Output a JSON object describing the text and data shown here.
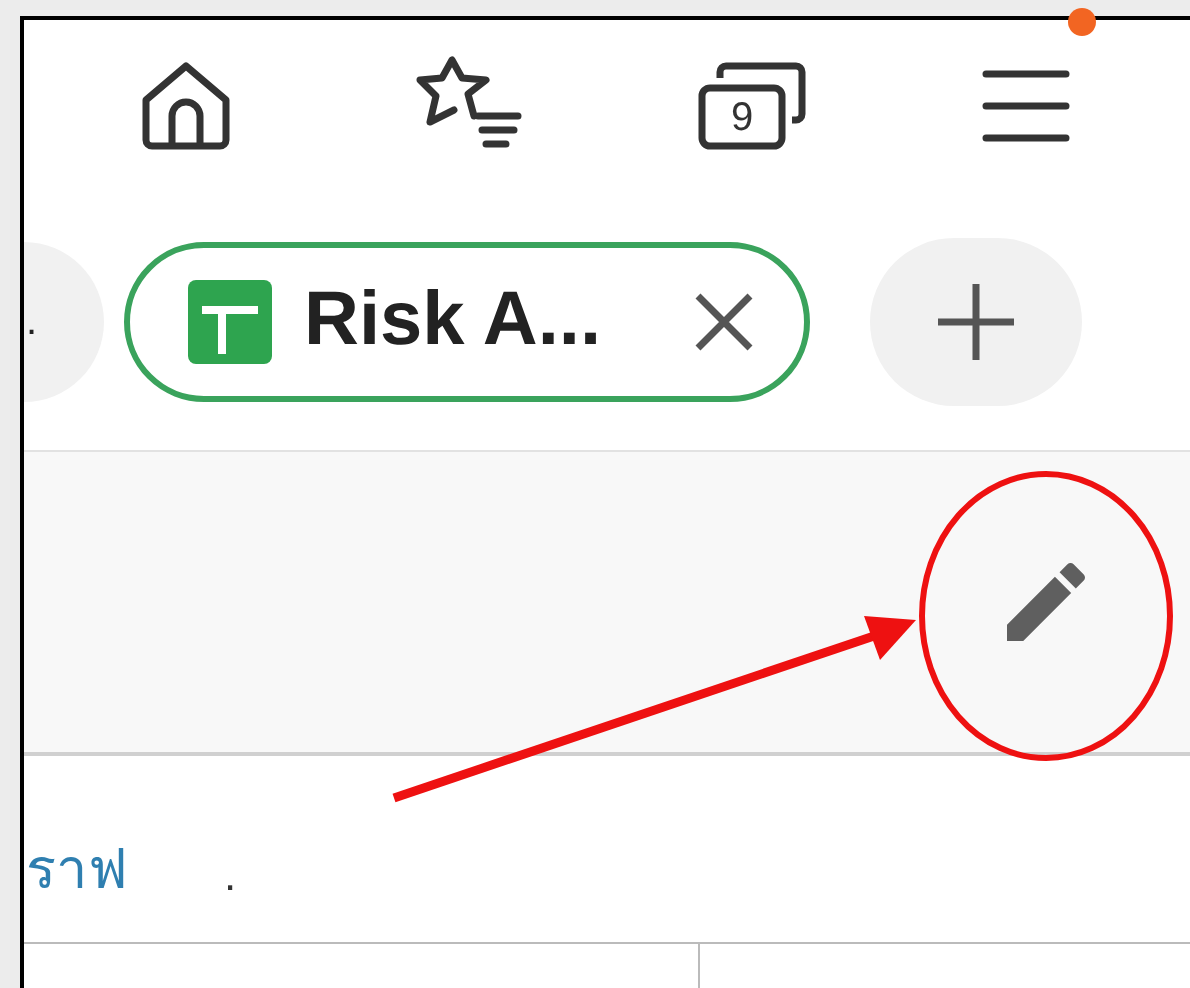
{
  "toolbar": {
    "tab_count": "9",
    "menu_notification": true
  },
  "tabs": [
    {
      "title": ".",
      "selected": false
    },
    {
      "title": "Risk A...",
      "selected": true
    }
  ],
  "content": {
    "link": "ราฟ",
    "text": "."
  }
}
